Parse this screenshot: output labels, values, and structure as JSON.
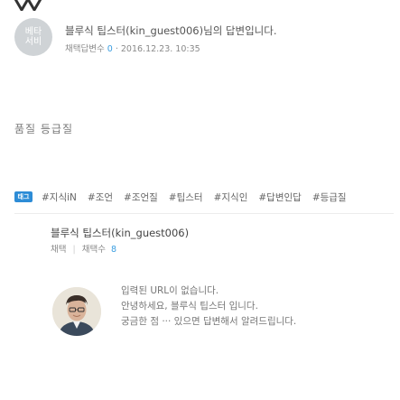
{
  "comment": {
    "badge_line1": "베타",
    "badge_line2": "서비",
    "header_text": "블루식 팁스터(kin_guest006)님의 답변입니다.",
    "meta_label": "채택답변수",
    "meta_count": "0",
    "meta_date": "2016.12.23. 10:35"
  },
  "related": {
    "title": "품질 등급질"
  },
  "tags": {
    "icon_label": "태그",
    "items": [
      "#지식iN",
      "#조언",
      "#조언질",
      "#팁스터",
      "#지식인",
      "#답변인답",
      "#등급질"
    ]
  },
  "author": {
    "name": "블루식 팁스터(kin_guest006)",
    "stat_label1": "채택",
    "stat_sep": "|",
    "stat_label2": "채택수",
    "stat_value": "8",
    "profile_lines": [
      "입력된 URL이 없습니다.",
      "안녕하세요, 블루식 팁스터 입니다.",
      "궁금한 점 ··· 있으면 답변해서 알려드립니다."
    ]
  },
  "colors": {
    "accent": "#3a9de0",
    "tag_icon": "#2d8cd6",
    "badge": "#cfd3d6"
  }
}
